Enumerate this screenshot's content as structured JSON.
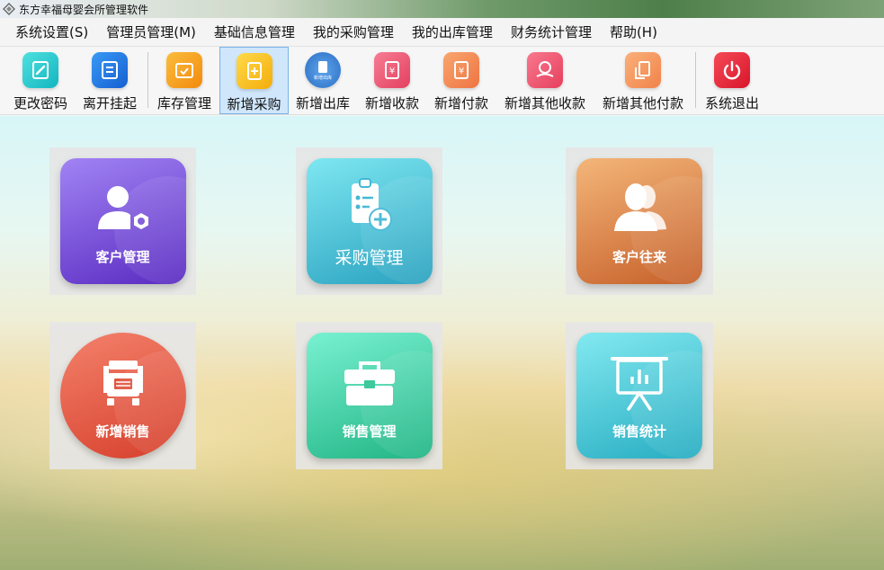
{
  "window": {
    "title": "东方幸福母婴会所管理软件"
  },
  "menu": {
    "items": [
      {
        "label": "系统设置(S)"
      },
      {
        "label": "管理员管理(M)"
      },
      {
        "label": "基础信息管理"
      },
      {
        "label": "我的采购管理"
      },
      {
        "label": "我的出库管理"
      },
      {
        "label": "财务统计管理"
      },
      {
        "label": "帮助(H)"
      }
    ]
  },
  "toolbar": {
    "buttons": [
      {
        "label": "更改密码",
        "icon": "edit-password-icon",
        "color": "#19c6c9"
      },
      {
        "label": "离开挂起",
        "icon": "lock-screen-icon",
        "color": "#1e7be6"
      },
      {
        "label": "库存管理",
        "icon": "inventory-box-icon",
        "color": "#f7a21b"
      },
      {
        "label": "新增采购",
        "icon": "purchase-add-icon",
        "color": "#f5c31a"
      },
      {
        "label": "新增出库",
        "icon": "outbound-add-icon",
        "color": "#3a86d6"
      },
      {
        "label": "新增收款",
        "icon": "receipt-add-icon",
        "color": "#ef5b78"
      },
      {
        "label": "新增付款",
        "icon": "payment-add-icon",
        "color": "#f48a55"
      },
      {
        "label": "新增其他收款",
        "icon": "other-receipt-icon",
        "color": "#f05a74"
      },
      {
        "label": "新增其他付款",
        "icon": "other-payment-icon",
        "color": "#f59a5a"
      },
      {
        "label": "系统退出",
        "icon": "power-icon",
        "color": "#e8283c"
      }
    ],
    "outbound_icon_caption": "新增出库"
  },
  "tiles": [
    {
      "label": "客户管理",
      "icon": "customer-settings-icon",
      "colors": [
        "#9c7cf0",
        "#5c2fc4"
      ]
    },
    {
      "label": "采购管理",
      "icon": "clipboard-add-icon",
      "colors": [
        "#76e3ee",
        "#2aa6c2"
      ]
    },
    {
      "label": "客户往来",
      "icon": "users-icon",
      "colors": [
        "#f2b273",
        "#c9662c"
      ]
    },
    {
      "label": "新增销售",
      "icon": "truck-icon",
      "colors": [
        "#f47f68",
        "#d8442e"
      ]
    },
    {
      "label": "销售管理",
      "icon": "briefcase-icon",
      "colors": [
        "#6ff0cf",
        "#22b887"
      ]
    },
    {
      "label": "销售统计",
      "icon": "presentation-chart-icon",
      "colors": [
        "#7ce8ee",
        "#27b1c5"
      ]
    }
  ]
}
